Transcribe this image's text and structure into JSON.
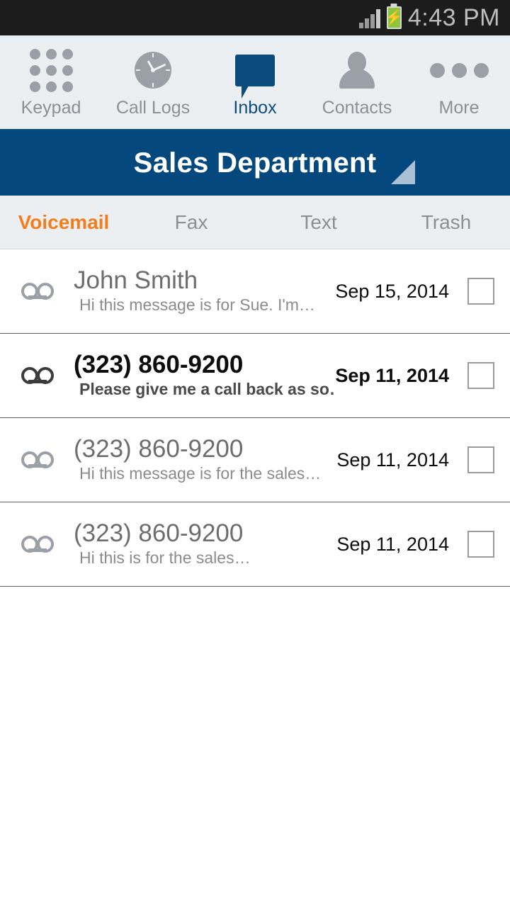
{
  "status_bar": {
    "time": "4:43 PM",
    "signal_icon": "signal-bars-icon",
    "battery_icon": "battery-charging-icon",
    "battery_color": "#8cc63e"
  },
  "top_nav": {
    "active_color": "#0c4c7c",
    "items": [
      {
        "label": "Keypad",
        "icon": "keypad-grid-icon",
        "active": false
      },
      {
        "label": "Call Logs",
        "icon": "clock-icon",
        "active": false
      },
      {
        "label": "Inbox",
        "icon": "speech-bubble-icon",
        "active": true
      },
      {
        "label": "Contacts",
        "icon": "person-icon",
        "active": false
      },
      {
        "label": "More",
        "icon": "ellipsis-icon",
        "active": false
      }
    ]
  },
  "header": {
    "title": "Sales Department",
    "background_color": "#04487e",
    "expand_indicator_icon": "corner-triangle-icon",
    "expand_indicator_color": "#a9c0d5"
  },
  "tabs": {
    "active_color": "#f07d1e",
    "items": [
      {
        "label": "Voicemail",
        "active": true
      },
      {
        "label": "Fax",
        "active": false
      },
      {
        "label": "Text",
        "active": false
      },
      {
        "label": "Trash",
        "active": false
      }
    ]
  },
  "messages": [
    {
      "icon": "voicemail-icon",
      "title": "John Smith",
      "preview": "Hi this message is for Sue. I'm…",
      "date": "Sep 15, 2014",
      "unread": false,
      "checked": false
    },
    {
      "icon": "voicemail-icon",
      "title": "(323) 860-9200",
      "preview": "Please give me a call back as so…",
      "date": "Sep 11, 2014",
      "unread": true,
      "checked": false
    },
    {
      "icon": "voicemail-icon",
      "title": "(323) 860-9200",
      "preview": "Hi this message is for the sales…",
      "date": "Sep 11, 2014",
      "unread": false,
      "checked": false
    },
    {
      "icon": "voicemail-icon",
      "title": "(323) 860-9200",
      "preview": "Hi this is for the sales…",
      "date": "Sep 11, 2014",
      "unread": false,
      "checked": false
    }
  ]
}
